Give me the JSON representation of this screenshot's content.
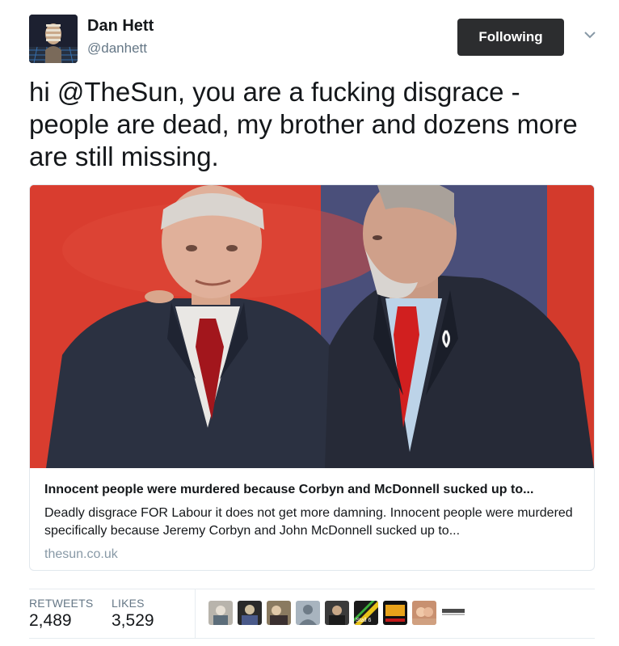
{
  "author": {
    "name": "Dan Hett",
    "handle": "@danhett",
    "avatar_icon": "profile-avatar"
  },
  "follow_button": {
    "label": "Following",
    "bg_color": "#2c2d2f"
  },
  "menu_icon": "chevron-down-icon",
  "tweet": {
    "text": "hi @TheSun, you are a fucking disgrace - people are dead, my brother and dozens more are still missing."
  },
  "card": {
    "title": "Innocent people were murdered because Corbyn and McDonnell sucked up to...",
    "description": "Deadly disgrace FOR Labour it does not get more damning. Innocent people were murdered specifically because Jeremy Corbyn and John McDonnell sucked up to...",
    "domain": "thesun.co.uk",
    "image_icon": "card-photo"
  },
  "stats": {
    "retweets_label": "RETWEETS",
    "retweets_value": "2,489",
    "likes_label": "LIKES",
    "likes_value": "3,529"
  },
  "likers": {
    "avatar_icons": [
      "liker-avatar-1",
      "liker-avatar-2",
      "liker-avatar-3",
      "liker-avatar-4",
      "liker-avatar-5",
      "liker-avatar-6",
      "liker-avatar-7",
      "liker-avatar-8",
      "liker-avatar-9"
    ],
    "avatar_text": [
      "",
      "",
      "",
      "",
      "",
      "Stall 6",
      "",
      "",
      ""
    ]
  },
  "colors": {
    "text_primary": "#14171a",
    "text_secondary": "#657786",
    "border": "#e1e8ed"
  }
}
